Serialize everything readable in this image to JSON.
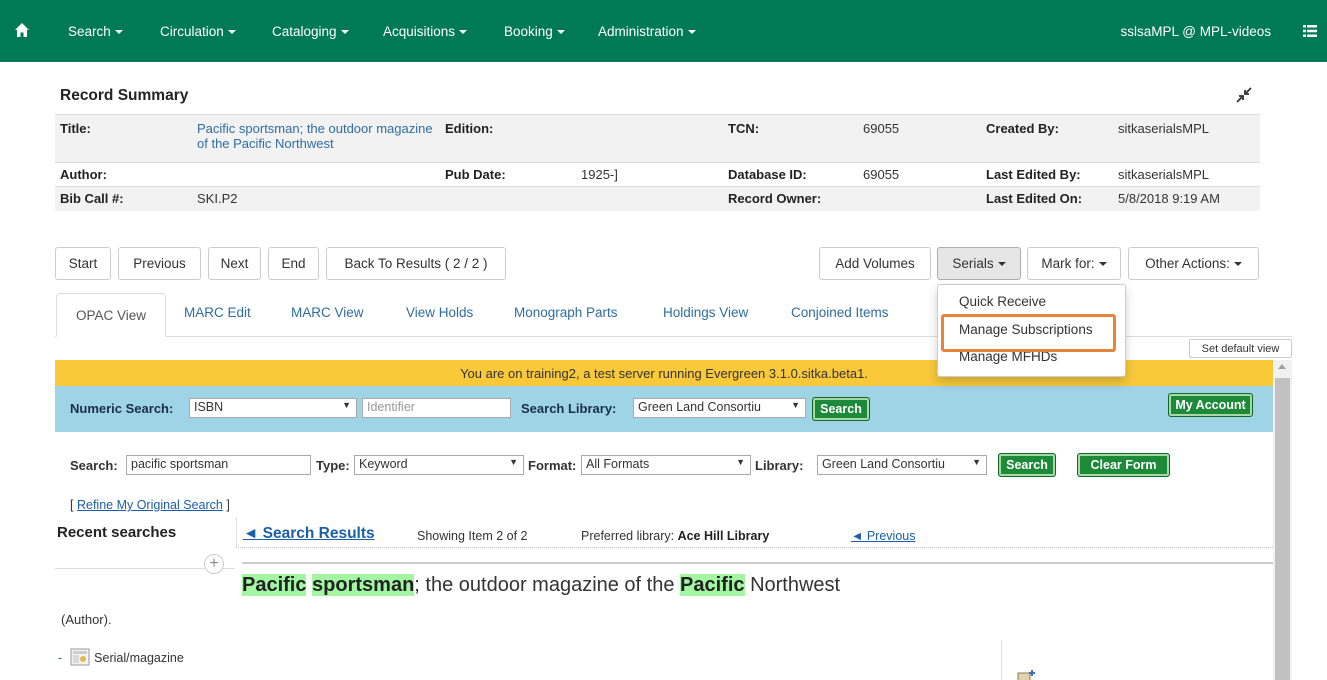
{
  "nav": {
    "items": [
      {
        "label": "Search"
      },
      {
        "label": "Circulation"
      },
      {
        "label": "Cataloging"
      },
      {
        "label": "Acquisitions"
      },
      {
        "label": "Booking"
      },
      {
        "label": "Administration"
      }
    ],
    "user": "sslsaMPL @ MPL-videos",
    "colors": {
      "navbar": "#007a54"
    }
  },
  "record_summary": {
    "heading": "Record Summary",
    "title_label": "Title:",
    "title_value": "Pacific sportsman; the outdoor magazine of the Pacific Northwest",
    "edition_label": "Edition:",
    "edition_value": "",
    "tcn_label": "TCN:",
    "tcn_value": "69055",
    "created_by_label": "Created By:",
    "created_by_value": "sitkaserialsMPL",
    "author_label": "Author:",
    "author_value": "",
    "pub_date_label": "Pub Date:",
    "pub_date_value": "1925-]",
    "db_id_label": "Database ID:",
    "db_id_value": "69055",
    "last_edited_by_label": "Last Edited By:",
    "last_edited_by_value": "sitkaserialsMPL",
    "call_label": "Bib Call #:",
    "call_value": "SKI.P2",
    "owner_label": "Record Owner:",
    "owner_value": "",
    "last_edited_on_label": "Last Edited On:",
    "last_edited_on_value": "5/8/2018 9:19 AM"
  },
  "buttons": {
    "start": "Start",
    "previous": "Previous",
    "next": "Next",
    "end": "End",
    "back": "Back To Results ( 2 / 2 )",
    "add_volumes": "Add Volumes",
    "serials": "Serials",
    "mark_for": "Mark for:",
    "other_actions": "Other Actions:"
  },
  "serials_menu": {
    "items": [
      "Quick Receive",
      "Manage Subscriptions",
      "Manage MFHDs"
    ],
    "highlighted": "Manage Subscriptions",
    "highlight_color": "#e8833a"
  },
  "tabs": [
    "OPAC View",
    "MARC Edit",
    "MARC View",
    "View Holds",
    "Monograph Parts",
    "Holdings View",
    "Conjoined Items"
  ],
  "active_tab": "OPAC View",
  "set_default_view": "Set default view",
  "opac": {
    "banner": "You are on training2, a test server running Evergreen 3.1.0.sitka.beta1.",
    "numeric_search_label": "Numeric Search:",
    "numeric_type": "ISBN",
    "identifier_placeholder": "Identifier",
    "search_library_label": "Search Library:",
    "search_library_value": "Green Land Consortiu",
    "search_button": "Search",
    "my_account": "My Account",
    "search_label": "Search:",
    "search_value": "pacific sportsman",
    "type_label": "Type:",
    "type_value": "Keyword",
    "format_label": "Format:",
    "format_value": "All Formats",
    "library_label": "Library:",
    "library_value": "Green Land Consortiu",
    "search_button2": "Search",
    "clear_form": "Clear Form",
    "refine_prefix": "[",
    "refine_link": "Refine My Original Search",
    "refine_suffix": "]",
    "recent_searches": "Recent searches",
    "search_results": "◄ Search Results",
    "showing": "Showing Item 2 of 2",
    "preferred_label": "Preferred library:",
    "preferred_value": "Ace Hill Library",
    "previous": "◄ Previous",
    "title_parts": {
      "w1": "Pacific",
      "w2": "sportsman",
      "w3": "; the outdoor magazine of the ",
      "w4": "Pacific",
      "w5": " Northwest"
    },
    "author": "(Author).",
    "format_text": "Serial/magazine",
    "banner_color": "#f9c93a",
    "numbar_color": "#9fd3e6"
  }
}
